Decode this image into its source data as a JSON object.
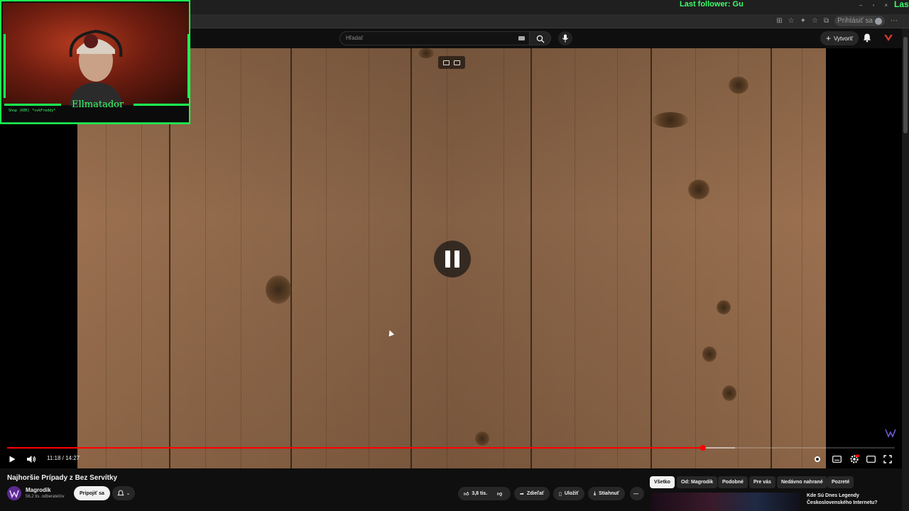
{
  "overlay": {
    "follower_text": "Last follower: Gu",
    "follower_edge": "Last",
    "streamer_name": "Ellmatador",
    "streamer_sub": "Shop (KEK) *svkFreddy*"
  },
  "browser": {
    "signin_label": "Prihlásiť sa",
    "window_controls": [
      "–",
      "▫",
      "×"
    ]
  },
  "header": {
    "search_placeholder": "Hľadať",
    "create_label": "Vytvoriť",
    "icons": [
      "search-icon",
      "mic-icon",
      "bell-icon"
    ]
  },
  "player": {
    "time_text": "11:18 / 14:27",
    "progress": 0.784,
    "buffered": 0.82,
    "state": "paused-indicator"
  },
  "video_info": {
    "title": "Najhoršie Prípady z Bez Servítky",
    "channel_name": "Magrodik",
    "subscribers": "56,2 tis. odberateľov",
    "join_label": "Pripojiť sa",
    "likes": "3,8 tis.",
    "share_label": "Zdieľať",
    "save_label": "Uložiť",
    "download_label": "Stiahnuť"
  },
  "chips": [
    "Všetko",
    "Od: Magrodik",
    "Podobné",
    "Pre vás",
    "Nedávno nahrané",
    "Pozreté"
  ],
  "recommendation": {
    "title": "Kde Sú Dnes Legendy Československého Internetu?"
  },
  "colors": {
    "accent": "#ff0000",
    "overlay_green": "#1cff52",
    "background": "#0f0f0f"
  }
}
